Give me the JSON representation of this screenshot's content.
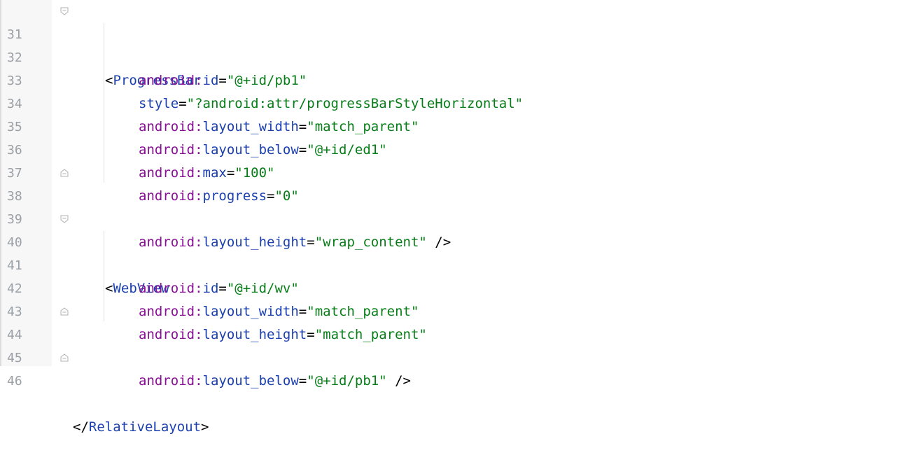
{
  "line_numbers": [
    "31",
    "32",
    "33",
    "34",
    "35",
    "36",
    "37",
    "38",
    "39",
    "40",
    "41",
    "42",
    "43",
    "44",
    "45",
    "46"
  ],
  "code": {
    "l31": {
      "open": "<",
      "tag": "ProgressBar"
    },
    "l32": {
      "ns": "android:",
      "attr": "id",
      "eq": "=",
      "val": "\"@+id/pb1\""
    },
    "l33": {
      "attr": "style",
      "eq": "=",
      "val": "\"?android:attr/progressBarStyleHorizontal\""
    },
    "l34": {
      "ns": "android:",
      "attr": "layout_width",
      "eq": "=",
      "val": "\"match_parent\""
    },
    "l35": {
      "ns": "android:",
      "attr": "layout_below",
      "eq": "=",
      "val": "\"@+id/ed1\""
    },
    "l36": {
      "ns": "android:",
      "attr": "max",
      "eq": "=",
      "val": "\"100\""
    },
    "l37": {
      "ns": "android:",
      "attr": "progress",
      "eq": "=",
      "val": "\"0\""
    },
    "l38": {
      "ns": "android:",
      "attr": "layout_height",
      "eq": "=",
      "val": "\"wrap_content\"",
      "close": " />"
    },
    "l40": {
      "open": "<",
      "tag": "WebView"
    },
    "l41": {
      "ns": "android:",
      "attr": "id",
      "eq": "=",
      "val": "\"@+id/wv\""
    },
    "l42": {
      "ns": "android:",
      "attr": "layout_width",
      "eq": "=",
      "val": "\"match_parent\""
    },
    "l43": {
      "ns": "android:",
      "attr": "layout_height",
      "eq": "=",
      "val": "\"match_parent\""
    },
    "l44": {
      "ns": "android:",
      "attr": "layout_below",
      "eq": "=",
      "val": "\"@+id/pb1\"",
      "close": " />"
    },
    "l46": {
      "open": "</",
      "tag": "RelativeLayout",
      "close": ">"
    }
  },
  "colors": {
    "tag": "#1a3fae",
    "namespace": "#871094",
    "attribute": "#1a3fae",
    "value": "#067d17",
    "line_number": "#9aa0a6"
  },
  "icons": [
    "fold-open-icon",
    "fold-close-icon"
  ]
}
